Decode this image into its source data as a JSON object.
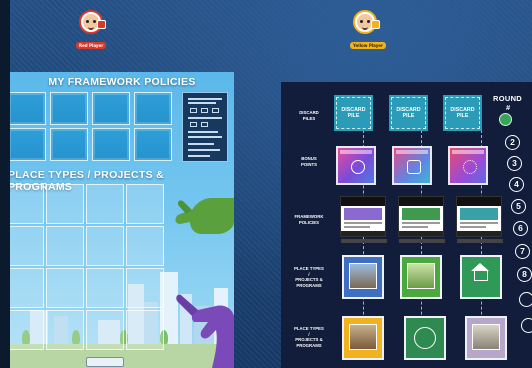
{
  "players": [
    {
      "name": "Red Player",
      "color": "#d63a2b"
    },
    {
      "name": "Yellow Player",
      "color": "#f2b319"
    }
  ],
  "left_board": {
    "title_policies": "MY FRAMEWORK POLICIES",
    "title_place_types": "PLACE TYPES / PROJECTS & PROGRAMS"
  },
  "right_board": {
    "row_labels": [
      [
        "DISCARD",
        "PILES"
      ],
      [
        "BONUS",
        "POINTS"
      ],
      [
        "FRAMEWORK",
        "POLICIES"
      ],
      [
        "PLACE TYPES",
        "/",
        "PROJECTS &",
        "PROGRAMS"
      ],
      [
        "PLACE TYPES",
        "/",
        "PROJECTS &",
        "PROGRAMS"
      ]
    ],
    "discard_piles": [
      [
        "DISCARD",
        "PILE"
      ],
      [
        "DISCARD",
        "PILE"
      ],
      [
        "DISCARD",
        "PILE"
      ]
    ],
    "round": {
      "title": "ROUND",
      "title_suffix": "#",
      "numbers": [
        "2",
        "3",
        "4",
        "5",
        "6",
        "7",
        "8"
      ]
    }
  },
  "colors": {
    "bonus_card": "#e94aa0",
    "framework_card": "#ffffff",
    "place_green": "#3e9a4f",
    "place_blue": "#3f6fc0",
    "round_marker": "#3aa35b"
  },
  "icons": {
    "bonus": [
      "people-icon",
      "transit-icon",
      "gears-icon"
    ],
    "place_top": [
      "building-photo",
      "park-photo",
      "house-icon"
    ],
    "place_bottom": [
      "school-photo",
      "cyclist-icon",
      "home-photo"
    ]
  }
}
